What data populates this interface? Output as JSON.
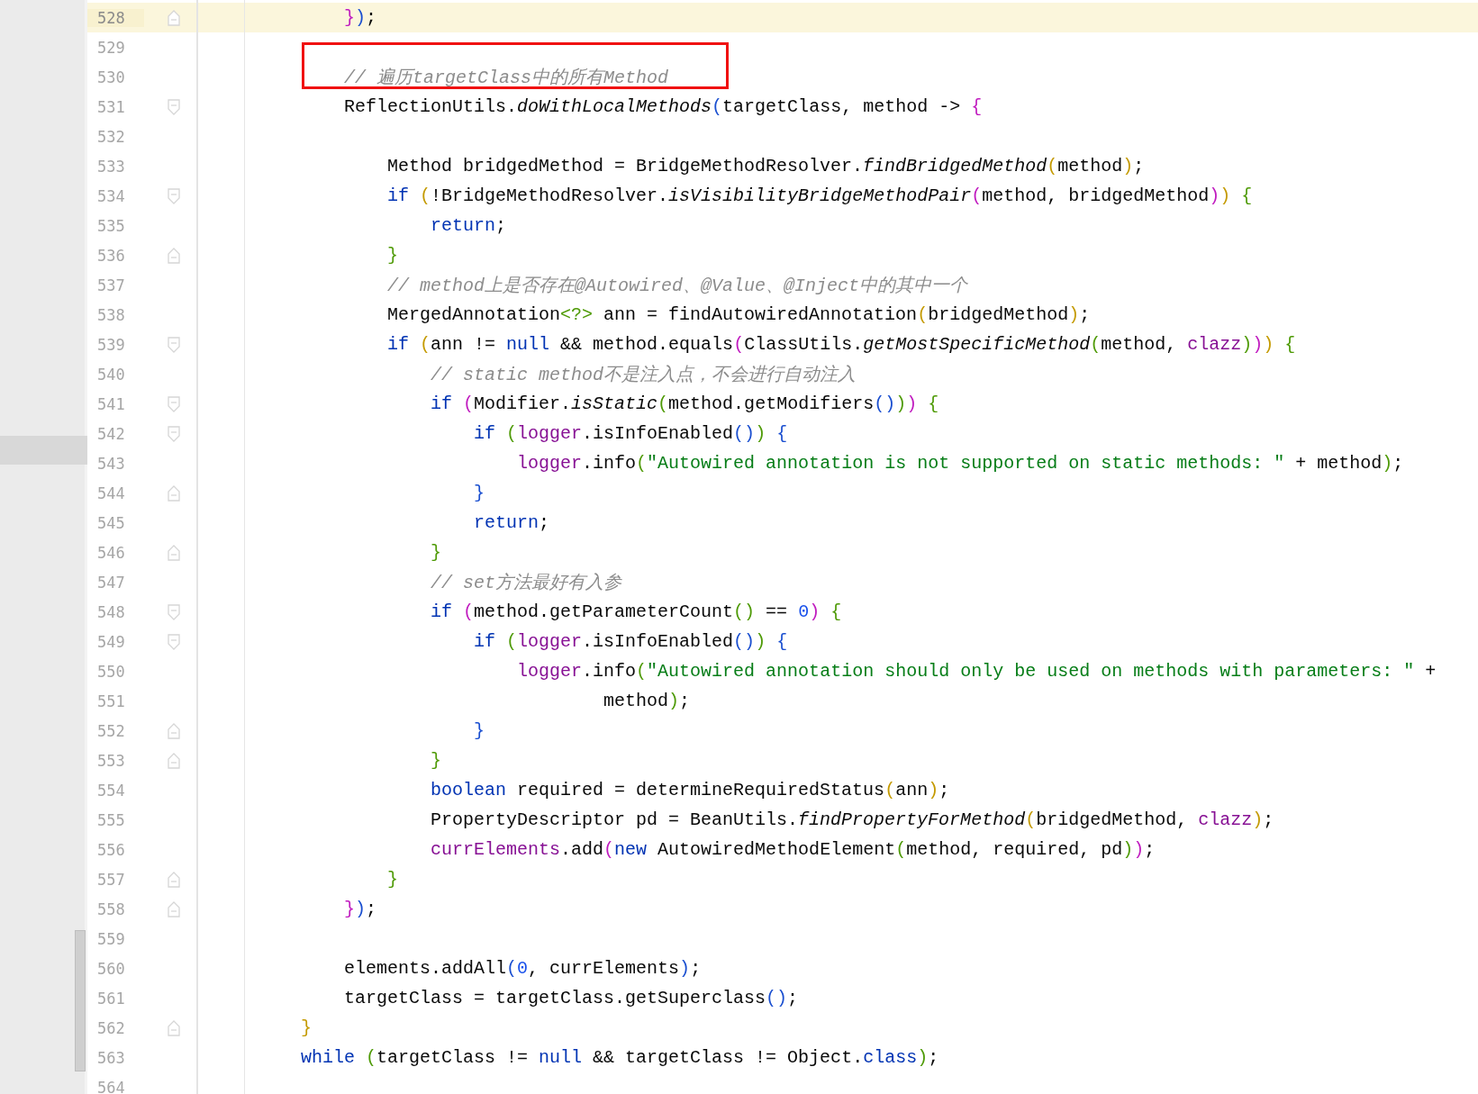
{
  "editor": {
    "lines": [
      {
        "number": "528",
        "selected": true,
        "kind": "closer",
        "tokens": [
          {
            "t": "    }",
            "kind": "bracket",
            "color": "#c01bbf"
          },
          {
            "t": ")",
            "kind": "bracket",
            "color": "#1a4fd0"
          },
          {
            "t": ";",
            "kind": "plain"
          }
        ]
      },
      {
        "number": "529",
        "selected": false,
        "kind": "plain"
      },
      {
        "number": "530",
        "selected": false,
        "kind": "plain",
        "tokens": [
          {
            "t": "    // 遍历targetClass中的所有Method",
            "kind": "comment"
          }
        ]
      },
      {
        "number": "531",
        "selected": false,
        "kind": "opener",
        "tokens": [
          {
            "t": "    ReflectionUtils.",
            "kind": "plain"
          },
          {
            "t": "doWithLocalMethods",
            "kind": "call"
          },
          {
            "t": "(",
            "kind": "bracket",
            "color": "#1a4fd0"
          },
          {
            "t": "targetClass, method -> ",
            "kind": "plain"
          },
          {
            "t": "{",
            "kind": "bracket",
            "color": "#c01bbf"
          }
        ]
      },
      {
        "number": "532",
        "selected": false,
        "kind": "plain"
      },
      {
        "number": "533",
        "selected": false,
        "kind": "plain",
        "tokens": [
          {
            "t": "        Method bridgedMethod = BridgeMethodResolver.",
            "kind": "plain"
          },
          {
            "t": "findBridgedMethod",
            "kind": "call"
          },
          {
            "t": "(",
            "kind": "bracket",
            "color": "#c49a00"
          },
          {
            "t": "method",
            "kind": "plain"
          },
          {
            "t": ")",
            "kind": "bracket",
            "color": "#c49a00"
          },
          {
            "t": ";",
            "kind": "plain"
          }
        ]
      },
      {
        "number": "534",
        "selected": false,
        "kind": "opener",
        "tokens": [
          {
            "t": "        if ",
            "kind": "keyword"
          },
          {
            "t": "(",
            "kind": "bracket",
            "color": "#c49a00"
          },
          {
            "t": "!BridgeMethodResolver.",
            "kind": "plain"
          },
          {
            "t": "isVisibilityBridgeMethodPair",
            "kind": "call"
          },
          {
            "t": "(",
            "kind": "bracket",
            "color": "#c01bbf"
          },
          {
            "t": "method, bridgedMethod",
            "kind": "plain"
          },
          {
            "t": ")",
            "kind": "bracket",
            "color": "#c01bbf"
          },
          {
            "t": ") ",
            "kind": "bracket",
            "color": "#c49a00"
          },
          {
            "t": "{",
            "kind": "bracket",
            "color": "#4e9a06"
          }
        ]
      },
      {
        "number": "535",
        "selected": false,
        "kind": "plain",
        "tokens": [
          {
            "t": "            return",
            "kind": "keyword"
          },
          {
            "t": ";",
            "kind": "plain"
          }
        ]
      },
      {
        "number": "536",
        "selected": false,
        "kind": "closer",
        "tokens": [
          {
            "t": "        }",
            "kind": "bracket",
            "color": "#4e9a06"
          }
        ]
      },
      {
        "number": "537",
        "selected": false,
        "kind": "plain",
        "tokens": [
          {
            "t": "        // method上是否存在@Autowired、@Value、@Inject中的其中一个",
            "kind": "comment"
          }
        ]
      },
      {
        "number": "538",
        "selected": false,
        "kind": "plain",
        "tokens": [
          {
            "t": "        MergedAnnotation",
            "kind": "plain"
          },
          {
            "t": "<?>",
            "kind": "bracket",
            "color": "#4e9a06"
          },
          {
            "t": " ann = findAutowiredAnnotation",
            "kind": "plain"
          },
          {
            "t": "(",
            "kind": "bracket",
            "color": "#c49a00"
          },
          {
            "t": "bridgedMethod",
            "kind": "plain"
          },
          {
            "t": ")",
            "kind": "bracket",
            "color": "#c49a00"
          },
          {
            "t": ";",
            "kind": "plain"
          }
        ]
      },
      {
        "number": "539",
        "selected": false,
        "kind": "opener",
        "tokens": [
          {
            "t": "        if ",
            "kind": "keyword"
          },
          {
            "t": "(",
            "kind": "bracket",
            "color": "#c49a00"
          },
          {
            "t": "ann != ",
            "kind": "plain"
          },
          {
            "t": "null",
            "kind": "keyword"
          },
          {
            "t": " && method.equals",
            "kind": "plain"
          },
          {
            "t": "(",
            "kind": "bracket",
            "color": "#c01bbf"
          },
          {
            "t": "ClassUtils.",
            "kind": "plain"
          },
          {
            "t": "getMostSpecificMethod",
            "kind": "call"
          },
          {
            "t": "(",
            "kind": "bracket",
            "color": "#4e9a06"
          },
          {
            "t": "method, ",
            "kind": "plain"
          },
          {
            "t": "clazz",
            "kind": "field"
          },
          {
            "t": ")",
            "kind": "bracket",
            "color": "#4e9a06"
          },
          {
            "t": ")",
            "kind": "bracket",
            "color": "#c01bbf"
          },
          {
            "t": ") ",
            "kind": "bracket",
            "color": "#c49a00"
          },
          {
            "t": "{",
            "kind": "bracket",
            "color": "#4e9a06"
          }
        ]
      },
      {
        "number": "540",
        "selected": false,
        "kind": "plain",
        "tokens": [
          {
            "t": "            // static method不是注入点，不会进行自动注入",
            "kind": "comment"
          }
        ]
      },
      {
        "number": "541",
        "selected": false,
        "kind": "opener",
        "tokens": [
          {
            "t": "            if ",
            "kind": "keyword"
          },
          {
            "t": "(",
            "kind": "bracket",
            "color": "#c01bbf"
          },
          {
            "t": "Modifier.",
            "kind": "plain"
          },
          {
            "t": "isStatic",
            "kind": "call"
          },
          {
            "t": "(",
            "kind": "bracket",
            "color": "#4e9a06"
          },
          {
            "t": "method.getModifiers",
            "kind": "plain"
          },
          {
            "t": "()",
            "kind": "bracket",
            "color": "#1a4fd0"
          },
          {
            "t": ")",
            "kind": "bracket",
            "color": "#4e9a06"
          },
          {
            "t": ") ",
            "kind": "bracket",
            "color": "#c01bbf"
          },
          {
            "t": "{",
            "kind": "bracket",
            "color": "#4e9a06"
          }
        ]
      },
      {
        "number": "542",
        "selected": false,
        "kind": "opener",
        "tokens": [
          {
            "t": "                if ",
            "kind": "keyword"
          },
          {
            "t": "(",
            "kind": "bracket",
            "color": "#4e9a06"
          },
          {
            "t": "logger",
            "kind": "field"
          },
          {
            "t": ".isInfoEnabled",
            "kind": "plain"
          },
          {
            "t": "()",
            "kind": "bracket",
            "color": "#1a4fd0"
          },
          {
            "t": ") ",
            "kind": "bracket",
            "color": "#4e9a06"
          },
          {
            "t": "{",
            "kind": "bracket",
            "color": "#1a4fd0"
          }
        ]
      },
      {
        "number": "543",
        "selected": false,
        "kind": "plain",
        "tokens": [
          {
            "t": "                    logger",
            "kind": "field"
          },
          {
            "t": ".info",
            "kind": "plain"
          },
          {
            "t": "(",
            "kind": "bracket",
            "color": "#4e9a06"
          },
          {
            "t": "\"Autowired annotation is not supported on static methods: \"",
            "kind": "string"
          },
          {
            "t": " + method",
            "kind": "plain"
          },
          {
            "t": ")",
            "kind": "bracket",
            "color": "#4e9a06"
          },
          {
            "t": ";",
            "kind": "plain"
          }
        ]
      },
      {
        "number": "544",
        "selected": false,
        "kind": "closer",
        "tokens": [
          {
            "t": "                }",
            "kind": "bracket",
            "color": "#1a4fd0"
          }
        ]
      },
      {
        "number": "545",
        "selected": false,
        "kind": "plain",
        "tokens": [
          {
            "t": "                return",
            "kind": "keyword"
          },
          {
            "t": ";",
            "kind": "plain"
          }
        ]
      },
      {
        "number": "546",
        "selected": false,
        "kind": "closer",
        "tokens": [
          {
            "t": "            }",
            "kind": "bracket",
            "color": "#4e9a06"
          }
        ]
      },
      {
        "number": "547",
        "selected": false,
        "kind": "plain",
        "tokens": [
          {
            "t": "            // set方法最好有入参",
            "kind": "comment"
          }
        ]
      },
      {
        "number": "548",
        "selected": false,
        "kind": "opener",
        "tokens": [
          {
            "t": "            if ",
            "kind": "keyword"
          },
          {
            "t": "(",
            "kind": "bracket",
            "color": "#c01bbf"
          },
          {
            "t": "method.getParameterCount",
            "kind": "plain"
          },
          {
            "t": "()",
            "kind": "bracket",
            "color": "#4e9a06"
          },
          {
            "t": " == ",
            "kind": "plain"
          },
          {
            "t": "0",
            "kind": "number"
          },
          {
            "t": ") ",
            "kind": "bracket",
            "color": "#c01bbf"
          },
          {
            "t": "{",
            "kind": "bracket",
            "color": "#4e9a06"
          }
        ]
      },
      {
        "number": "549",
        "selected": false,
        "kind": "opener",
        "tokens": [
          {
            "t": "                if ",
            "kind": "keyword"
          },
          {
            "t": "(",
            "kind": "bracket",
            "color": "#4e9a06"
          },
          {
            "t": "logger",
            "kind": "field"
          },
          {
            "t": ".isInfoEnabled",
            "kind": "plain"
          },
          {
            "t": "()",
            "kind": "bracket",
            "color": "#1a4fd0"
          },
          {
            "t": ") ",
            "kind": "bracket",
            "color": "#4e9a06"
          },
          {
            "t": "{",
            "kind": "bracket",
            "color": "#1a4fd0"
          }
        ]
      },
      {
        "number": "550",
        "selected": false,
        "kind": "plain",
        "tokens": [
          {
            "t": "                    logger",
            "kind": "field"
          },
          {
            "t": ".info",
            "kind": "plain"
          },
          {
            "t": "(",
            "kind": "bracket",
            "color": "#4e9a06"
          },
          {
            "t": "\"Autowired annotation should only be used on methods with parameters: \"",
            "kind": "string"
          },
          {
            "t": " +",
            "kind": "plain"
          }
        ]
      },
      {
        "number": "551",
        "selected": false,
        "kind": "plain",
        "tokens": [
          {
            "t": "                            method",
            "kind": "plain"
          },
          {
            "t": ")",
            "kind": "bracket",
            "color": "#4e9a06"
          },
          {
            "t": ";",
            "kind": "plain"
          }
        ]
      },
      {
        "number": "552",
        "selected": false,
        "kind": "closer",
        "tokens": [
          {
            "t": "                }",
            "kind": "bracket",
            "color": "#1a4fd0"
          }
        ]
      },
      {
        "number": "553",
        "selected": false,
        "kind": "closer",
        "tokens": [
          {
            "t": "            }",
            "kind": "bracket",
            "color": "#4e9a06"
          }
        ]
      },
      {
        "number": "554",
        "selected": false,
        "kind": "plain",
        "tokens": [
          {
            "t": "            boolean",
            "kind": "keyword"
          },
          {
            "t": " required = determineRequiredStatus",
            "kind": "plain"
          },
          {
            "t": "(",
            "kind": "bracket",
            "color": "#c49a00"
          },
          {
            "t": "ann",
            "kind": "plain"
          },
          {
            "t": ")",
            "kind": "bracket",
            "color": "#c49a00"
          },
          {
            "t": ";",
            "kind": "plain"
          }
        ]
      },
      {
        "number": "555",
        "selected": false,
        "kind": "plain",
        "tokens": [
          {
            "t": "            PropertyDescriptor pd = BeanUtils.",
            "kind": "plain"
          },
          {
            "t": "findPropertyForMethod",
            "kind": "call"
          },
          {
            "t": "(",
            "kind": "bracket",
            "color": "#c49a00"
          },
          {
            "t": "bridgedMethod, ",
            "kind": "plain"
          },
          {
            "t": "clazz",
            "kind": "field"
          },
          {
            "t": ")",
            "kind": "bracket",
            "color": "#c49a00"
          },
          {
            "t": ";",
            "kind": "plain"
          }
        ]
      },
      {
        "number": "556",
        "selected": false,
        "kind": "plain",
        "tokens": [
          {
            "t": "            currElements",
            "kind": "field"
          },
          {
            "t": ".add",
            "kind": "plain"
          },
          {
            "t": "(",
            "kind": "bracket",
            "color": "#c01bbf"
          },
          {
            "t": "new",
            "kind": "keyword"
          },
          {
            "t": " AutowiredMethodElement",
            "kind": "plain"
          },
          {
            "t": "(",
            "kind": "bracket",
            "color": "#4e9a06"
          },
          {
            "t": "method, required, pd",
            "kind": "plain"
          },
          {
            "t": ")",
            "kind": "bracket",
            "color": "#4e9a06"
          },
          {
            "t": ")",
            "kind": "bracket",
            "color": "#c01bbf"
          },
          {
            "t": ";",
            "kind": "plain"
          }
        ]
      },
      {
        "number": "557",
        "selected": false,
        "kind": "closer",
        "tokens": [
          {
            "t": "        }",
            "kind": "bracket",
            "color": "#4e9a06"
          }
        ]
      },
      {
        "number": "558",
        "selected": false,
        "kind": "closer",
        "tokens": [
          {
            "t": "    }",
            "kind": "bracket",
            "color": "#c01bbf"
          },
          {
            "t": ")",
            "kind": "bracket",
            "color": "#1a4fd0"
          },
          {
            "t": ";",
            "kind": "plain"
          }
        ]
      },
      {
        "number": "559",
        "selected": false,
        "kind": "plain"
      },
      {
        "number": "560",
        "selected": false,
        "kind": "plain",
        "tokens": [
          {
            "t": "    elements.addAll",
            "kind": "plain"
          },
          {
            "t": "(",
            "kind": "bracket",
            "color": "#1a4fd0"
          },
          {
            "t": "0",
            "kind": "number"
          },
          {
            "t": ", currElements",
            "kind": "plain"
          },
          {
            "t": ")",
            "kind": "bracket",
            "color": "#1a4fd0"
          },
          {
            "t": ";",
            "kind": "plain"
          }
        ]
      },
      {
        "number": "561",
        "selected": false,
        "kind": "plain",
        "tokens": [
          {
            "t": "    targetClass = targetClass.getSuperclass",
            "kind": "plain"
          },
          {
            "t": "()",
            "kind": "bracket",
            "color": "#1a4fd0"
          },
          {
            "t": ";",
            "kind": "plain"
          }
        ]
      },
      {
        "number": "562",
        "selected": false,
        "kind": "closer",
        "tokens": [
          {
            "t": "}",
            "kind": "bracket",
            "color": "#c49a00"
          }
        ]
      },
      {
        "number": "563",
        "selected": false,
        "kind": "plain",
        "tokens": [
          {
            "t": "while ",
            "kind": "keyword"
          },
          {
            "t": "(",
            "kind": "bracket",
            "color": "#4e9a06"
          },
          {
            "t": "targetClass != ",
            "kind": "plain"
          },
          {
            "t": "null",
            "kind": "keyword"
          },
          {
            "t": " && targetClass != Object.",
            "kind": "plain"
          },
          {
            "t": "class",
            "kind": "keyword"
          },
          {
            "t": ")",
            "kind": "bracket",
            "color": "#4e9a06"
          },
          {
            "t": ";",
            "kind": "plain"
          }
        ]
      },
      {
        "number": "564",
        "selected": false,
        "kind": "plain"
      }
    ]
  }
}
